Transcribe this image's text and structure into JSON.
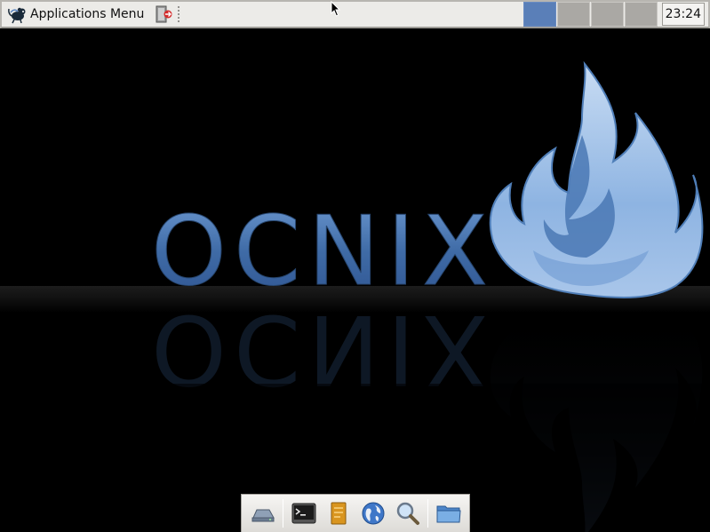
{
  "top_panel": {
    "apps_menu_label": "Applications Menu",
    "clock_time": "23:24",
    "workspaces": [
      {
        "name": "workspace-1",
        "active": true
      },
      {
        "name": "workspace-2",
        "active": false
      },
      {
        "name": "workspace-3",
        "active": false
      },
      {
        "name": "workspace-4",
        "active": false
      }
    ]
  },
  "wallpaper": {
    "brand_text": "OCNIX",
    "accent_color": "#4a78b4"
  },
  "dock": {
    "items": [
      {
        "icon": "drive-icon"
      },
      {
        "icon": "terminal-icon"
      },
      {
        "icon": "text-editor-icon"
      },
      {
        "icon": "web-browser-icon"
      },
      {
        "icon": "search-icon"
      },
      {
        "icon": "file-manager-icon"
      }
    ]
  }
}
